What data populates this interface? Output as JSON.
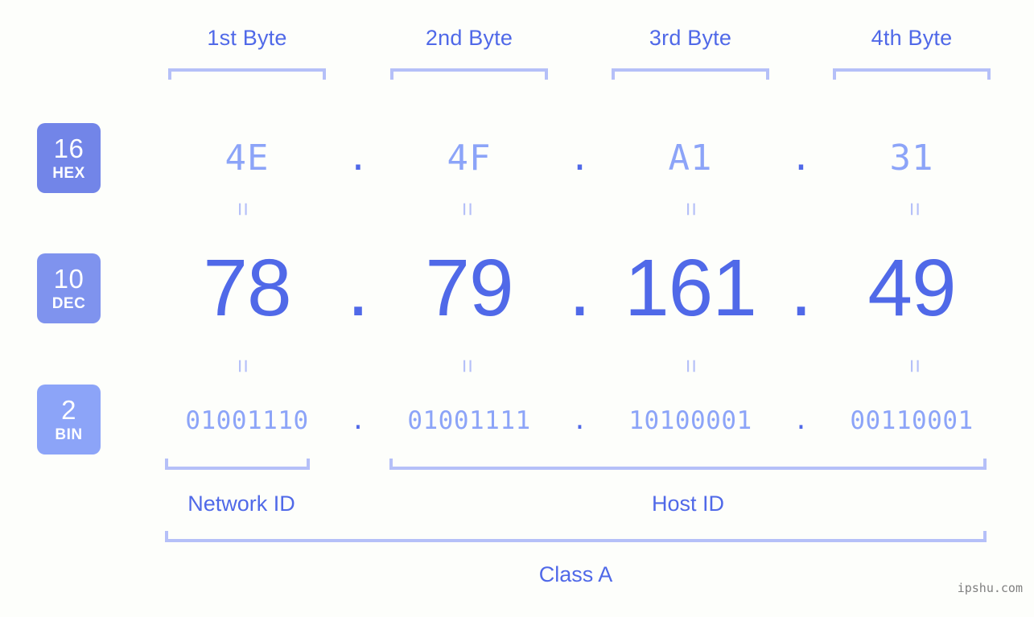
{
  "background_color": "#fdfefb",
  "accent_color": "#5069e8",
  "light_accent_color": "#8ca4f8",
  "bracket_color": "#b5c0f8",
  "byte_headers": [
    {
      "label": "1st Byte"
    },
    {
      "label": "2nd Byte"
    },
    {
      "label": "3rd Byte"
    },
    {
      "label": "4th Byte"
    }
  ],
  "bases": [
    {
      "id": "hex",
      "number": "16",
      "abbr": "HEX",
      "color": "#7285e8"
    },
    {
      "id": "dec",
      "number": "10",
      "abbr": "DEC",
      "color": "#7f93ee"
    },
    {
      "id": "bin",
      "number": "2",
      "abbr": "BIN",
      "color": "#8ca4f8"
    }
  ],
  "separator": ".",
  "equals_symbol": "=",
  "rows": {
    "hex": {
      "octets": [
        "4E",
        "4F",
        "A1",
        "31"
      ]
    },
    "dec": {
      "octets": [
        "78",
        "79",
        "161",
        "49"
      ]
    },
    "bin": {
      "octets": [
        "01001110",
        "01001111",
        "10100001",
        "00110001"
      ]
    }
  },
  "sections": {
    "network_id": "Network ID",
    "host_id": "Host ID",
    "class": "Class A"
  },
  "watermark": "ipshu.com"
}
